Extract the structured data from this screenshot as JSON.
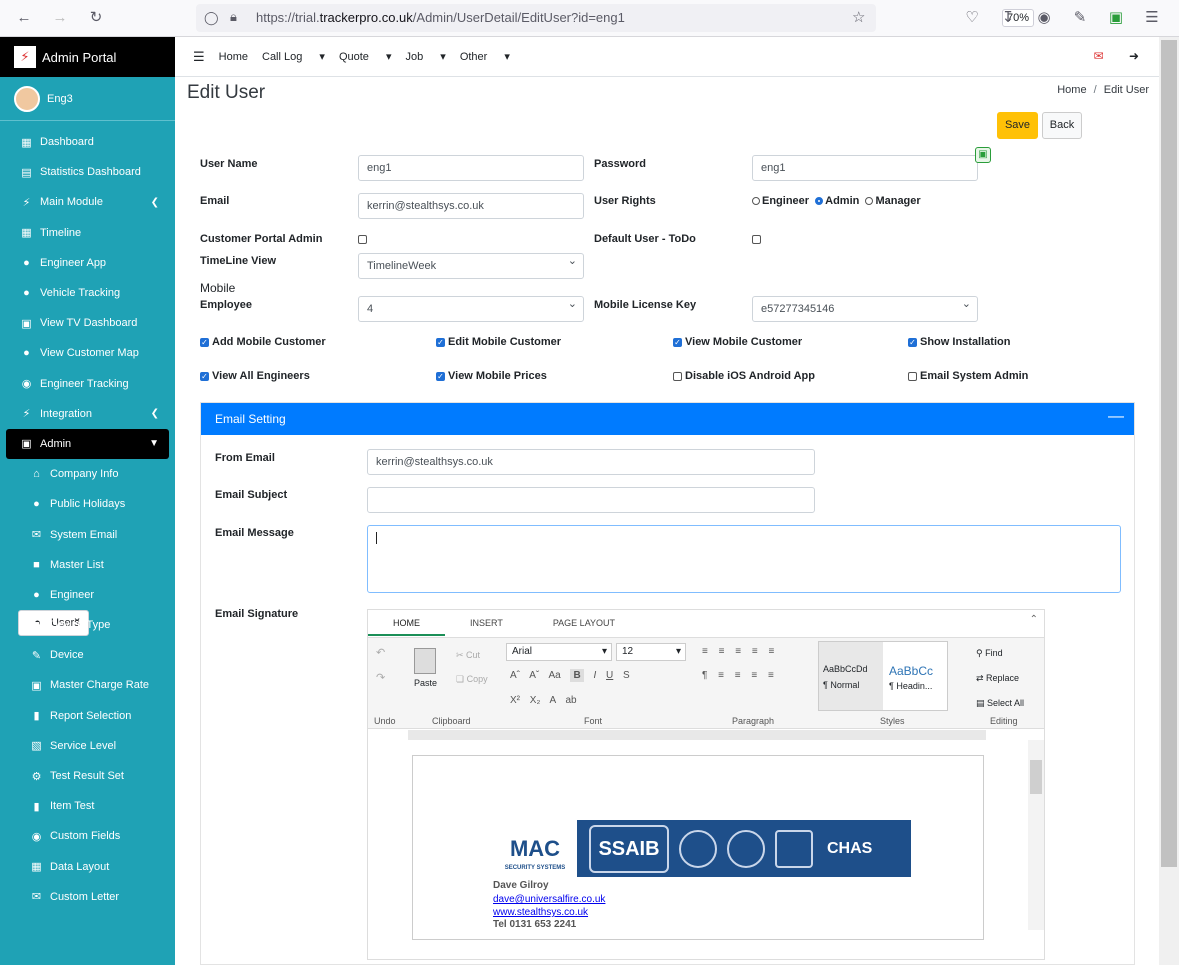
{
  "browser": {
    "url_prefix": "https://trial.",
    "url_domain": "trackerpro.co.uk",
    "url_path": "/Admin/UserDetail/EditUser?id=eng1",
    "zoom": "70%"
  },
  "sidebar": {
    "brand": "Admin Portal",
    "user": "Eng3",
    "items": [
      {
        "label": "Dashboard",
        "icon": "dashboard-icon"
      },
      {
        "label": "Statistics Dashboard",
        "icon": "chart-icon"
      },
      {
        "label": "Main Module",
        "icon": "plug-icon"
      },
      {
        "label": "Timeline",
        "icon": "calendar-icon"
      },
      {
        "label": "Engineer App",
        "icon": "users-icon"
      },
      {
        "label": "Vehicle Tracking",
        "icon": "driver-icon"
      },
      {
        "label": "View TV Dashboard",
        "icon": "tv-icon"
      },
      {
        "label": "View Customer Map",
        "icon": "users-icon"
      },
      {
        "label": "Engineer Tracking",
        "icon": "map-marker-icon"
      },
      {
        "label": "Integration",
        "icon": "plug-icon"
      },
      {
        "label": "Admin",
        "icon": "building-icon"
      }
    ],
    "subitems": [
      {
        "label": "Company Info",
        "icon": "home-icon"
      },
      {
        "label": "Public Holidays",
        "icon": "holiday-icon"
      },
      {
        "label": "System Email",
        "icon": "email-icon"
      },
      {
        "label": "Master List",
        "icon": "list-icon"
      },
      {
        "label": "Engineer",
        "icon": "user-icon"
      },
      {
        "label": "Users",
        "icon": "user-icon"
      },
      {
        "label": "Device Type",
        "icon": "device-icon"
      },
      {
        "label": "Device",
        "icon": "wrench-icon"
      },
      {
        "label": "Master Charge Rate",
        "icon": "money-icon"
      },
      {
        "label": "Report Selection",
        "icon": "file-icon"
      },
      {
        "label": "Service Level",
        "icon": "sitemap-icon"
      },
      {
        "label": "Test Result Set",
        "icon": "cog-icon"
      },
      {
        "label": "Item Test",
        "icon": "file-icon"
      },
      {
        "label": "Custom Fields",
        "icon": "robot-icon"
      },
      {
        "label": "Data Layout",
        "icon": "table-icon"
      },
      {
        "label": "Custom Letter",
        "icon": "envelope-icon"
      }
    ]
  },
  "topnav": {
    "home": "Home",
    "calllog": "Call Log",
    "quote": "Quote",
    "job": "Job",
    "other": "Other"
  },
  "page": {
    "title": "Edit User",
    "crumb_home": "Home",
    "crumb_sep": "/",
    "crumb_current": "Edit User",
    "save": "Save",
    "back": "Back"
  },
  "form": {
    "username_label": "User Name",
    "username": "eng1",
    "password_label": "Password",
    "password": "eng1",
    "email_label": "Email",
    "email": "kerrin@stealthsys.co.uk",
    "rights_label": "User Rights",
    "rights_engineer": "Engineer",
    "rights_admin": "Admin",
    "rights_manager": "Manager",
    "portal_label": "Customer Portal Admin",
    "default_label": "Default User - ToDo",
    "timeline_label": "TimeLine View",
    "timeline": "TimelineWeek",
    "mobile_label": "Mobile",
    "employee_label": "Employee",
    "employee": "4",
    "license_label": "Mobile License Key",
    "license": "e57277345146",
    "checks": [
      {
        "label": "Add Mobile Customer",
        "checked": true
      },
      {
        "label": "Edit Mobile Customer",
        "checked": true
      },
      {
        "label": "View Mobile Customer",
        "checked": true
      },
      {
        "label": "Show Installation",
        "checked": true
      },
      {
        "label": "View All Engineers",
        "checked": true
      },
      {
        "label": "View Mobile Prices",
        "checked": true
      },
      {
        "label": "Disable iOS Android App",
        "checked": false
      },
      {
        "label": "Email System Admin",
        "checked": false
      }
    ]
  },
  "email": {
    "panel_title": "Email Setting",
    "from_label": "From Email",
    "from": "kerrin@stealthsys.co.uk",
    "subject_label": "Email Subject",
    "message_label": "Email Message",
    "signature_label": "Email Signature"
  },
  "editor": {
    "tabs": [
      "HOME",
      "INSERT",
      "PAGE LAYOUT"
    ],
    "cut": "Cut",
    "copy": "Copy",
    "paste": "Paste",
    "font": "Arial",
    "size": "12",
    "style1_sample": "AaBbCcDd",
    "style1": "¶ Normal",
    "style2_sample": "AaBbCc",
    "style2": "¶ Headin...",
    "find": "Find",
    "replace": "Replace",
    "selectall": "Select All",
    "groups": [
      "Undo",
      "Clipboard",
      "Font",
      "Paragraph",
      "Styles",
      "Editing"
    ],
    "sig_name": "Dave Gilroy",
    "sig_email": "dave@universalfire.co.uk",
    "sig_web": "www.stealthsys.co.uk",
    "sig_tel": "Tel 0131 653 2241",
    "logo_mac": "MAC",
    "logo_mac_sub": "SECURITY SYSTEMS",
    "logo_ssaib": "SSAIB",
    "logo_chas": "CHAS"
  }
}
